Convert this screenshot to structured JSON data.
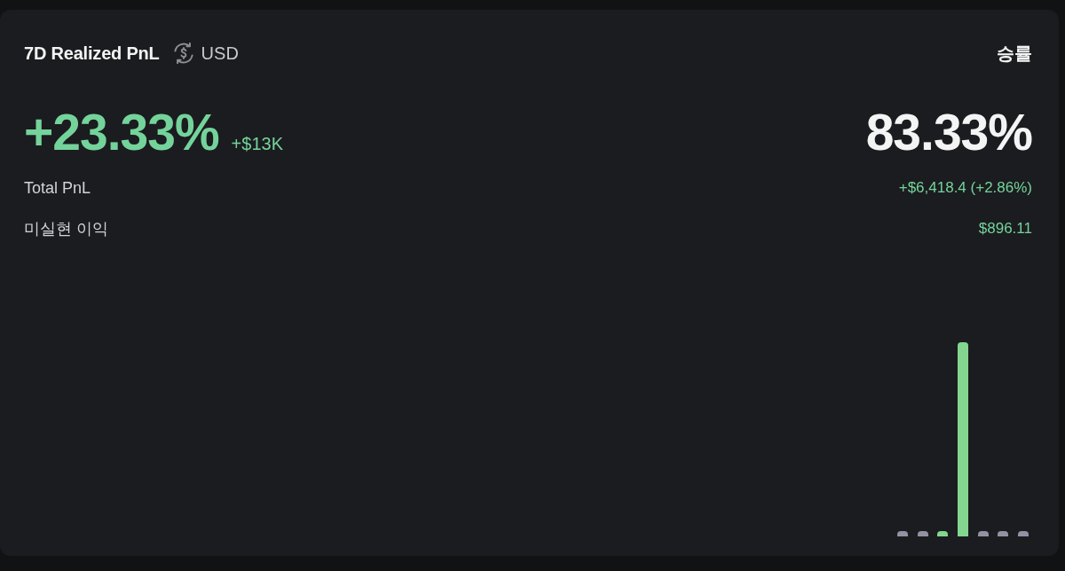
{
  "header": {
    "title": "7D Realized PnL",
    "currency": "USD",
    "win_rate_label": "승률"
  },
  "hero": {
    "pnl_percent": "+23.33%",
    "pnl_amount": "+$13K",
    "win_rate": "83.33%"
  },
  "rows": [
    {
      "label": "Total PnL",
      "value": "+$6,418.4 (+2.86%)"
    },
    {
      "label": "미실현 이익",
      "value": "$896.11"
    }
  ]
}
